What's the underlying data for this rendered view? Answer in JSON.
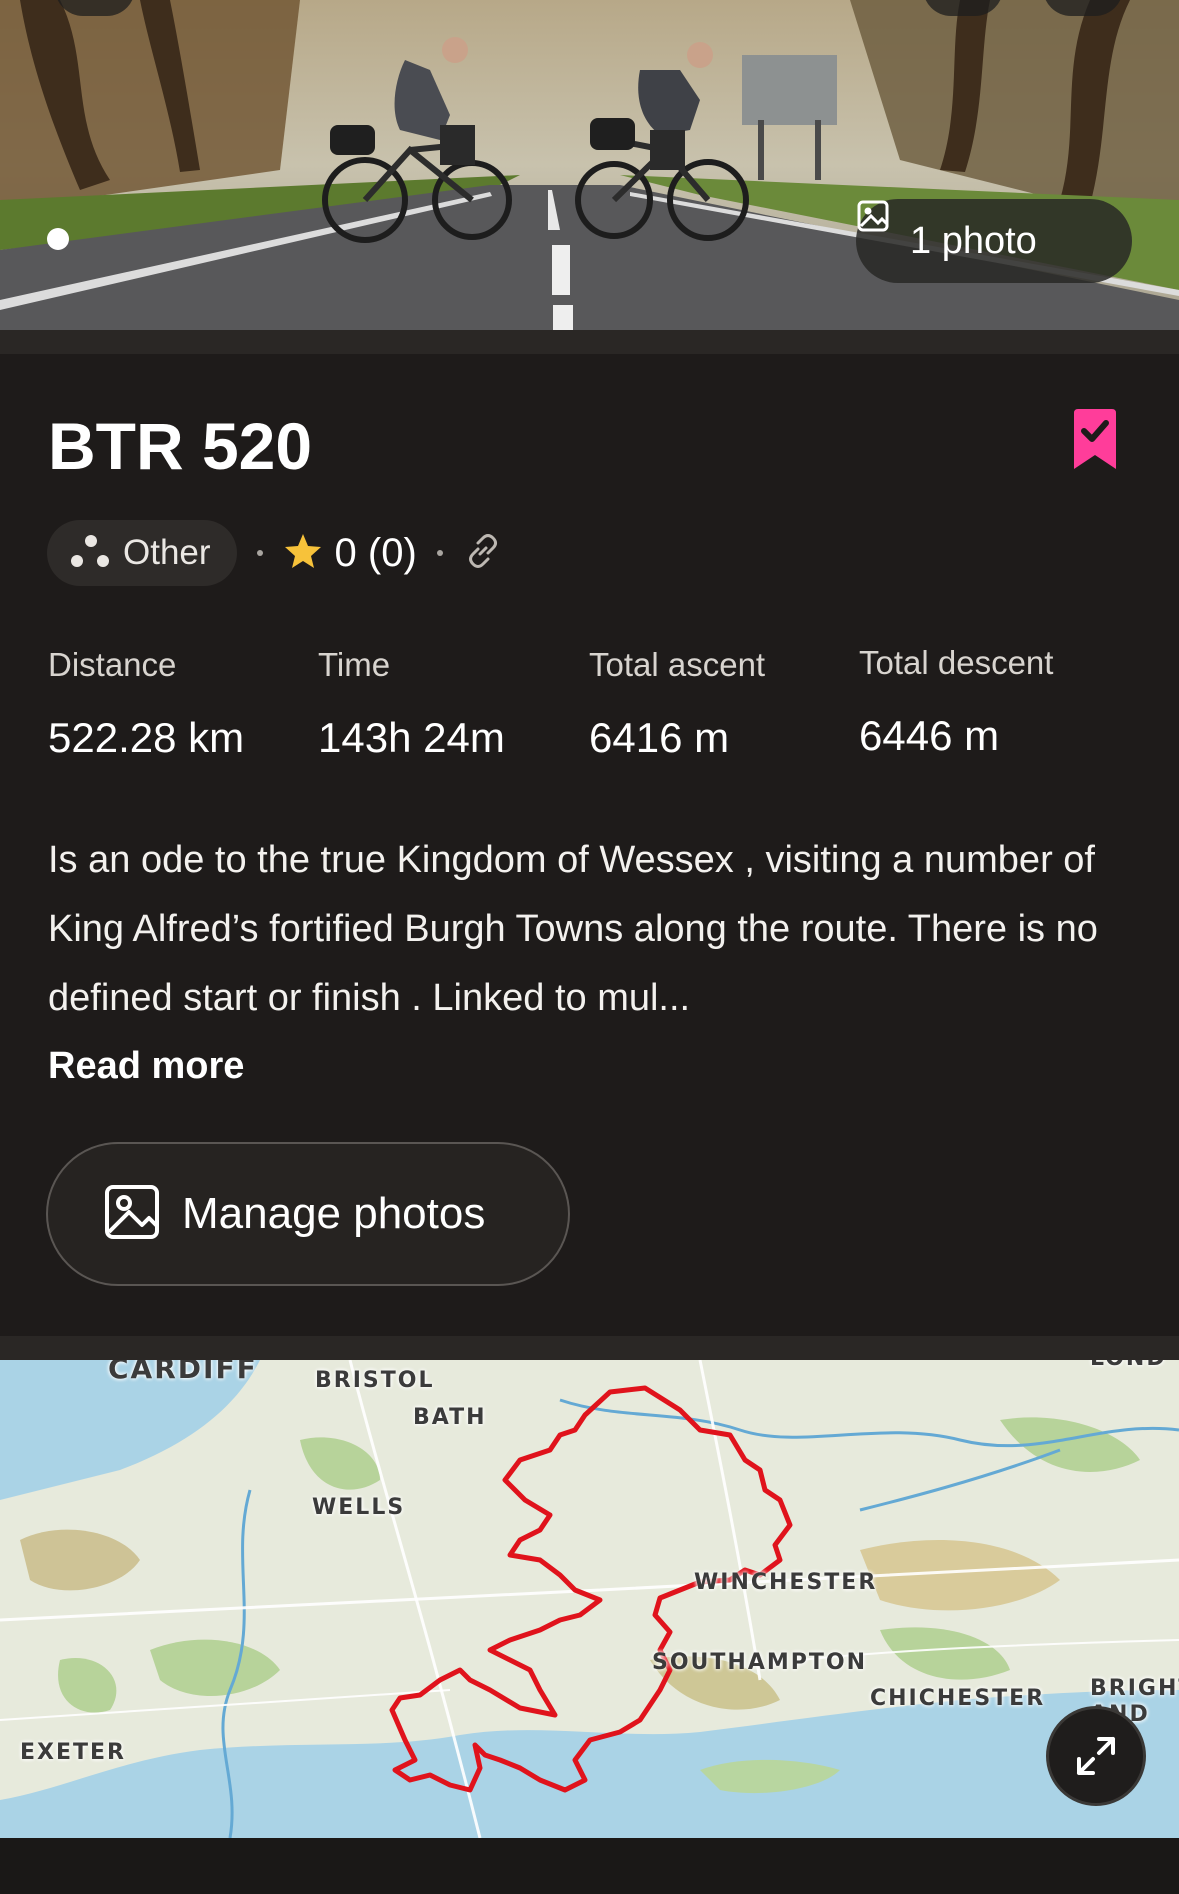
{
  "hero": {
    "photo_count_label": "1 photo",
    "image_alt": "Two cyclists with bikepacking bags crossing a tree-lined road"
  },
  "route": {
    "title": "BTR 520",
    "bookmarked": true,
    "sport": "Other",
    "rating": "0 (0)",
    "stats": [
      {
        "label": "Distance",
        "value": "522.28 km"
      },
      {
        "label": "Time",
        "value": "143h 24m"
      },
      {
        "label": "Total ascent",
        "value": "6416 m"
      },
      {
        "label": "Total descent",
        "value": "6446 m"
      }
    ],
    "description": "Is an ode to the true Kingdom of Wessex , visiting a number of King Alfred’s fortified Burgh Towns along the route. There is no defined start or finish . Linked to mul...",
    "read_more": "Read more"
  },
  "actions": {
    "manage_photos": "Manage photos"
  },
  "map": {
    "labels": {
      "cardiff": "CARDIFF",
      "bristol": "BRISTOL",
      "bath": "BATH",
      "wells": "WELLS",
      "winchester": "WINCHESTER",
      "southampton": "SOUTHAMPTON",
      "chichester": "CHICHESTER",
      "brighton_1": "BRIGHT",
      "brighton_2": "AND H",
      "exeter": "EXETER",
      "london": "LOND"
    }
  },
  "colors": {
    "background": "#1e1b1a",
    "bookmark": "#ff3d9a",
    "star": "#f7c23a",
    "route_line": "#e0131c"
  },
  "icons": [
    "image-icon",
    "bookmark-check-icon",
    "sport-other-icon",
    "star-icon",
    "link-icon",
    "expand-icon"
  ]
}
